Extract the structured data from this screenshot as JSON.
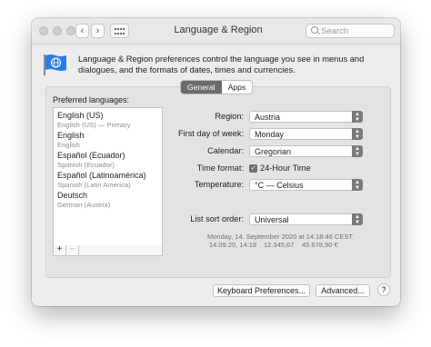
{
  "window": {
    "title": "Language & Region",
    "search_placeholder": "Search",
    "nav": {
      "back": "‹",
      "forward": "›"
    }
  },
  "description": "Language & Region preferences control the language you see in menus and dialogues, and the formats of dates, times and currencies.",
  "tabs": [
    {
      "label": "General",
      "active": true
    },
    {
      "label": "Apps",
      "active": false
    }
  ],
  "preferred": {
    "label": "Preferred languages:",
    "languages": [
      {
        "name": "English (US)",
        "sub": "English (US) — Primary"
      },
      {
        "name": "English",
        "sub": "English"
      },
      {
        "name": "Español (Ecuador)",
        "sub": "Spanish (Ecuador)"
      },
      {
        "name": "Español (Latinoamérica)",
        "sub": "Spanish (Latin America)"
      },
      {
        "name": "Deutsch",
        "sub": "German (Austria)"
      }
    ],
    "add": "+",
    "remove": "−"
  },
  "settings": {
    "region": {
      "label": "Region:",
      "value": "Austria"
    },
    "first_day": {
      "label": "First day of week:",
      "value": "Monday"
    },
    "calendar": {
      "label": "Calendar:",
      "value": "Gregorian"
    },
    "time_format": {
      "label": "Time format:",
      "option": "24-Hour Time",
      "checked": true
    },
    "temperature": {
      "label": "Temperature:",
      "value": "°C — Celsius"
    },
    "sort_order": {
      "label": "List sort order:",
      "value": "Universal"
    }
  },
  "sample": {
    "line1": "Monday, 14. September 2020 at 14:18:46 CEST",
    "date_short": "14.09.20, 14:18",
    "number": "12.345,67",
    "currency": "45.678,90 €"
  },
  "buttons": {
    "keyboard": "Keyboard Preferences...",
    "advanced": "Advanced...",
    "help": "?"
  },
  "colors": {
    "flag_icon": "#2b7de2",
    "selected_tab": "#6b6b6b"
  }
}
